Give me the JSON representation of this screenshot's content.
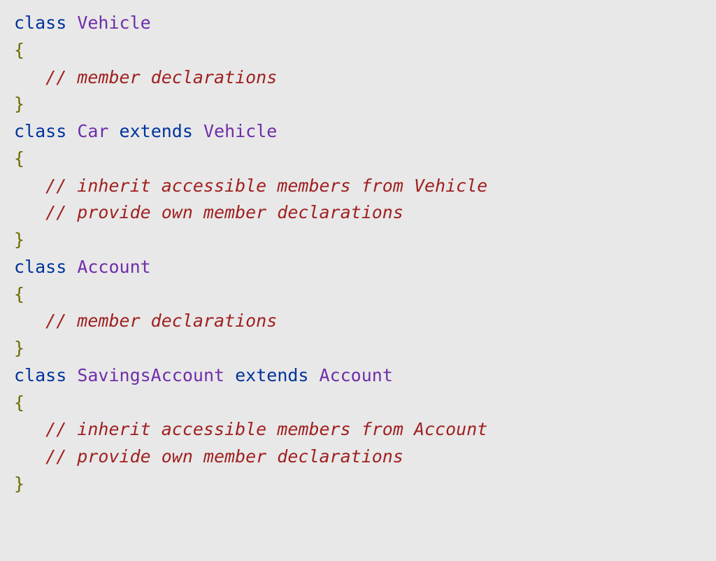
{
  "code": {
    "kw_class": "class",
    "kw_extends": "extends",
    "brace_open": "{",
    "brace_close": "}",
    "indent": "   ",
    "cls_vehicle": "Vehicle",
    "cls_car": "Car",
    "cls_account": "Account",
    "cls_savings": "SavingsAccount",
    "comment_member_decl": "// member declarations",
    "comment_inherit_vehicle": "// inherit accessible members from Vehicle",
    "comment_own_decl": "// provide own member declarations",
    "comment_inherit_account": "// inherit accessible members from Account"
  }
}
